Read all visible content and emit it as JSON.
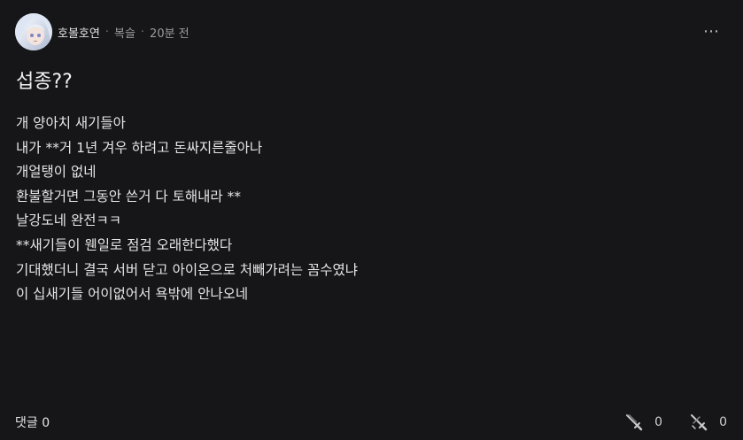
{
  "post": {
    "author": "호볼호연",
    "category": "복슬",
    "time": "20분 전",
    "title": "섭종??",
    "body_lines": [
      "개 양아치 새기들아",
      "내가 **거 1년 겨우 하려고 돈싸지른줄아나",
      "개얼탱이 없네",
      "환불할거면 그동안 쓴거 다 토해내라 **",
      "날강도네 완전ㅋㅋ",
      "**새기들이 웬일로 점검 오래한다했다",
      "기대했더니 결국 서버 닫고 아이온으로 처빼가려는 꼼수였냐",
      "이 십새기들 어이없어서 욕밖에 안나오네"
    ]
  },
  "header": {
    "more_icon": "⋯"
  },
  "footer": {
    "comments_label": "댓글 0",
    "like_count": "0",
    "dislike_count": "0"
  },
  "icons": {
    "avatar": "avatar",
    "more": "more-icon",
    "like": "sword-icon",
    "dislike": "crossed-sword-icon"
  },
  "colors": {
    "background": "#161618",
    "text": "#e6e6e6",
    "muted": "#9b9b9b"
  }
}
